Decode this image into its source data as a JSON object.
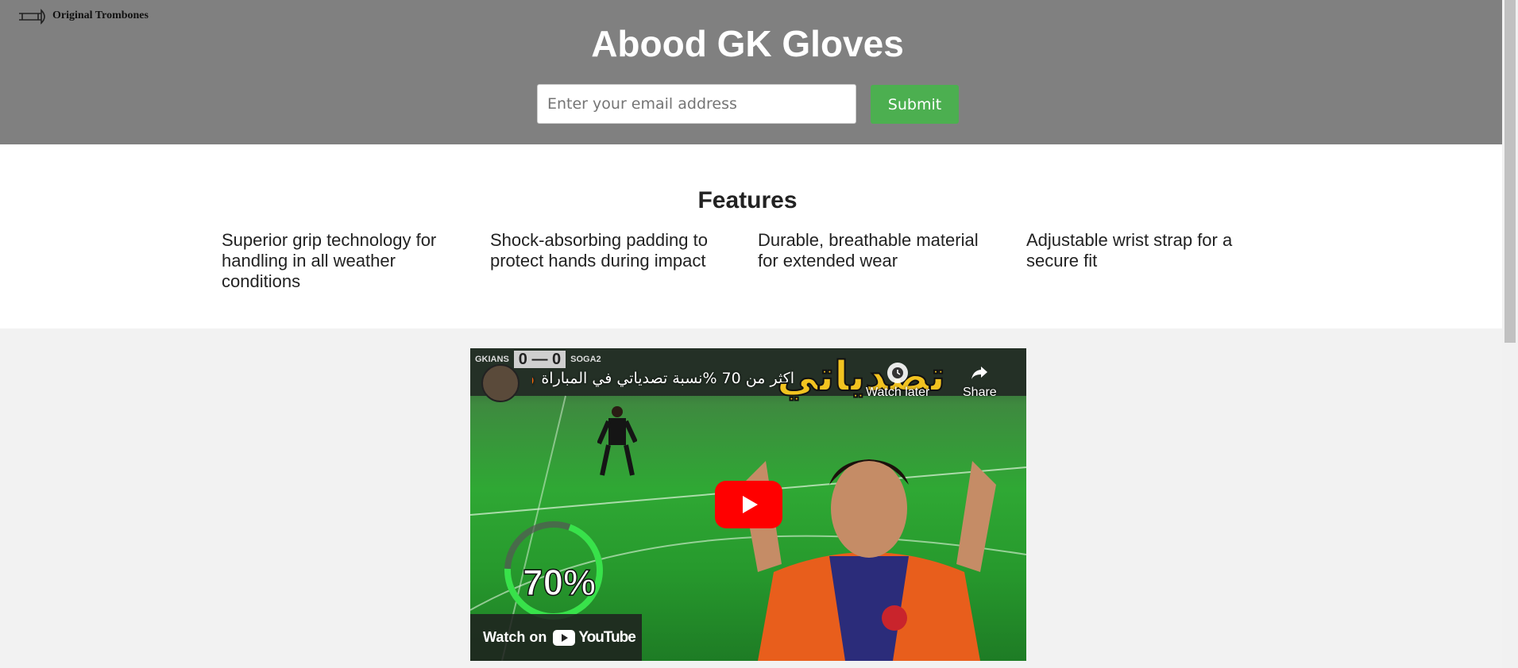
{
  "header": {
    "logo_text": "Original Trombones",
    "title": "Abood GK Gloves",
    "email_placeholder": "Enter your email address",
    "submit_label": "Submit"
  },
  "features": {
    "heading": "Features",
    "items": [
      "Superior grip technology for handling in all weather conditions",
      "Shock-absorbing padding to protect hands during impact",
      "Durable, breathable material for extended wear",
      "Adjustable wrist strap for a secure fit"
    ]
  },
  "video": {
    "scoreboard_left": "GKIANS",
    "score": "0 — 0",
    "scoreboard_right": "SOGA2",
    "title": "اكثر من 70 %نسبة تصدياتي في المباراة 🔥😱 |",
    "overlay_text": "تصدياتي",
    "watch_later_label": "Watch later",
    "share_label": "Share",
    "gauge_value": "70%",
    "gauge_fraction": 0.7,
    "watch_on_label": "Watch on",
    "youtube_label": "YouTube",
    "colors": {
      "play_button": "#ff0000",
      "gauge": "#38e24a"
    }
  },
  "colors": {
    "header_bg": "#808080",
    "submit_bg": "#4caf50",
    "page_bg": "#f2f2f2"
  }
}
